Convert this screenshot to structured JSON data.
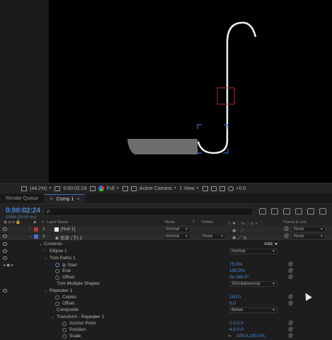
{
  "viewer": {
    "zoom": "(44.2%)",
    "timecode": "0:00:02:24",
    "resolution": "Full",
    "camera": "Active Camera",
    "views": "1 View",
    "exposure": "+0.0"
  },
  "tabs": [
    {
      "label": "Render Queue"
    },
    {
      "label": "Comp 1",
      "active": true
    }
  ],
  "timeline": {
    "timecode": "0:00:02:24",
    "fps": "00084 (30.00 fps)",
    "search_placeholder": "ρ·",
    "columns": {
      "num": "#",
      "layer_name": "Layer Name",
      "mode": "Mode",
      "t": "T",
      "trkmat": "TrkMat",
      "parent": "Parent & Link"
    }
  },
  "layers": [
    {
      "index": "1",
      "name": "[Null 1]",
      "mode": "Normal",
      "trkmat": "",
      "parent": "None",
      "color": "#b33a2f"
    },
    {
      "index": "2",
      "name": "★ 形状 (下) 2",
      "mode": "Normal",
      "trkmat": "None",
      "parent": "None",
      "color": "#4a6fd8"
    }
  ],
  "props": {
    "contents": "Contents",
    "add": "Add:",
    "ellipse": "Ellipse 1",
    "ellipse_mode": "Normal",
    "trim": "Trim Paths 1",
    "start_label": "Start",
    "start_val": "75.0%",
    "end_label": "End",
    "end_val": "100.0%",
    "offset_label": "Offset",
    "offset_val": "0x-180.0°",
    "tms_label": "Trim Multiple Shapes",
    "tms_val": "Simultaneously",
    "repeater": "Repeater 1",
    "copies_label": "Copies",
    "copies_val": "100.0",
    "roffset_label": "Offset",
    "roffset_val": "0.0",
    "composite_label": "Composite",
    "composite_val": "Below",
    "transform": "Transform : Repeater 1",
    "anchor_label": "Anchor Point",
    "anchor_val": "0.0,0.0",
    "position_label": "Position",
    "position_val": "4.0,0.0",
    "scale_label": "Scale",
    "scale_val": "100.0,100.0%"
  }
}
